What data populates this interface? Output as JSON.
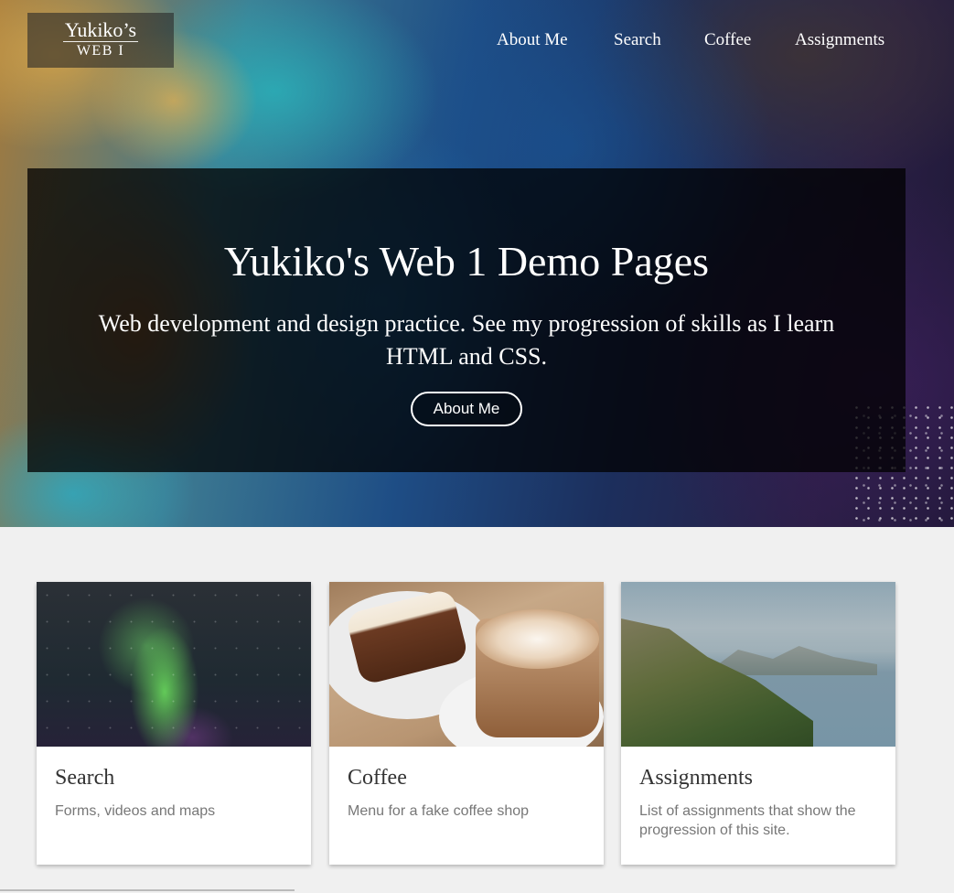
{
  "site": {
    "logo_line1": "Yukiko’s",
    "logo_line2": "WEB I"
  },
  "nav": {
    "items": [
      {
        "label": "About Me"
      },
      {
        "label": "Search"
      },
      {
        "label": "Coffee"
      },
      {
        "label": "Assignments"
      }
    ]
  },
  "hero": {
    "title": "Yukiko's Web 1 Demo Pages",
    "subtitle": "Web development and design practice. See my progression of skills as I learn HTML and CSS.",
    "button_label": "About Me"
  },
  "cards": [
    {
      "title": "Search",
      "description": "Forms, videos and maps",
      "image": "aurora-photo"
    },
    {
      "title": "Coffee",
      "description": "Menu for a fake coffee shop",
      "image": "latte-and-cake-photo"
    },
    {
      "title": "Assignments",
      "description": "List of assignments that show the progression of this site.",
      "image": "coastline-photo"
    }
  ],
  "colors": {
    "page_background": "#f0f0f0",
    "card_background": "#ffffff",
    "banner_overlay": "rgba(0,0,0,0.75)"
  }
}
